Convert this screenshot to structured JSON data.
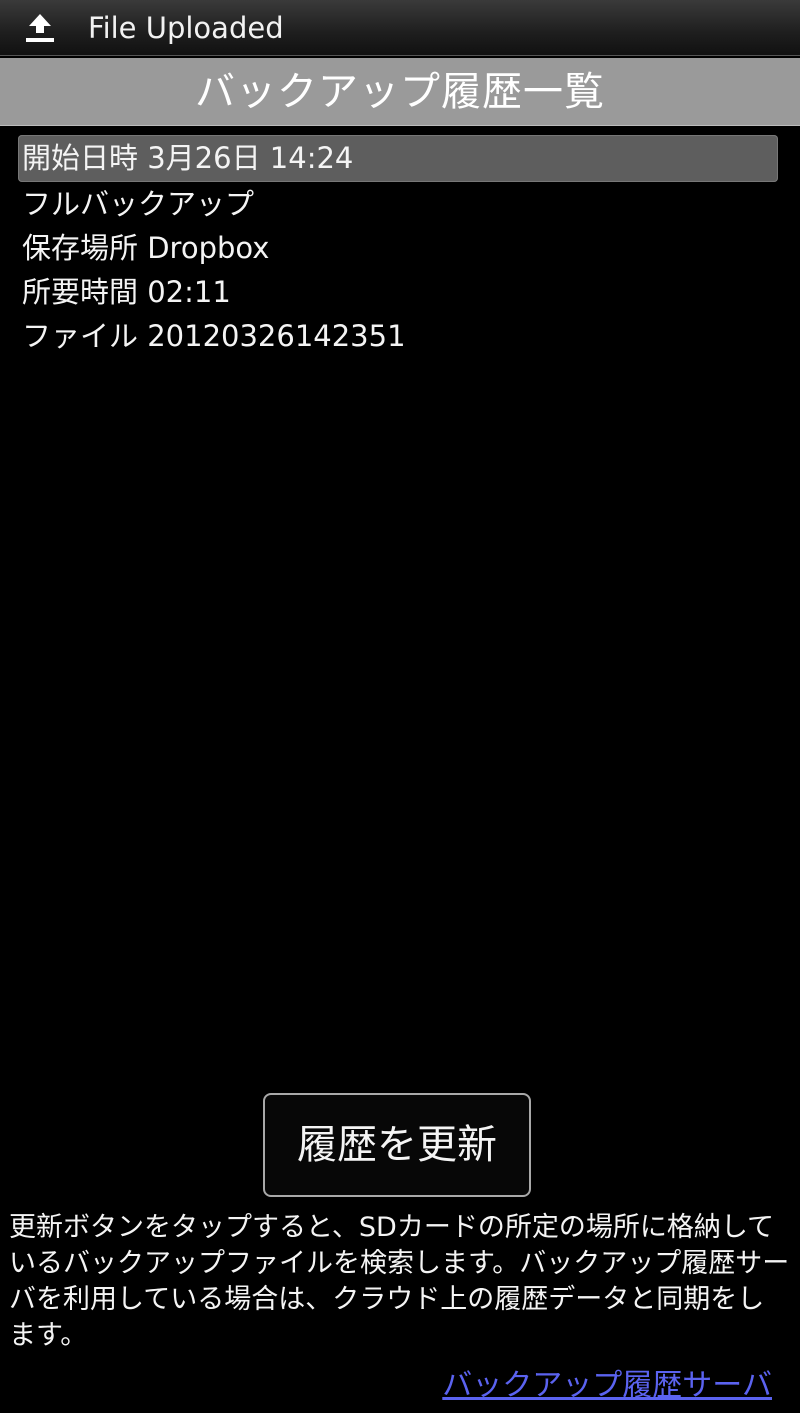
{
  "status_bar": {
    "icon": "upload-icon",
    "notification_text": "File Uploaded"
  },
  "header": {
    "title": "バックアップ履歴一覧"
  },
  "history": {
    "items": [
      {
        "start_time": "開始日時 3月26日 14:24",
        "backup_type": "フルバックアップ",
        "storage": "保存場所 Dropbox",
        "duration": "所要時間 02:11",
        "file": "ファイル 20120326142351"
      }
    ]
  },
  "actions": {
    "refresh_label": "履歴を更新"
  },
  "description": "更新ボタンをタップすると、SDカードの所定の場所に格納しているバックアップファイルを検索します。バックアップ履歴サーバを利用している場合は、クラウド上の履歴データと同期をします。",
  "links": {
    "server_label": "バックアップ履歴サーバ"
  },
  "colors": {
    "background": "#000000",
    "title_bar": "#9a9a9a",
    "selected_row": "#5e5e5e",
    "link": "#5b63f0"
  }
}
